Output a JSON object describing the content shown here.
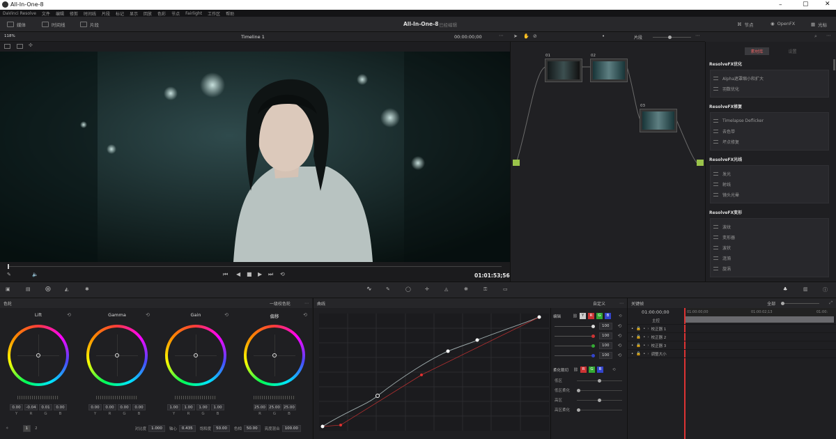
{
  "window": {
    "title": "All-In-One-8"
  },
  "menu": [
    "DaVinci Resolve",
    "文件",
    "编辑",
    "修剪",
    "时间线",
    "片段",
    "标记",
    "显示",
    "回放",
    "色彩",
    "节点",
    "Fairlight",
    "工作区",
    "帮助"
  ],
  "pagebar": {
    "left": [
      "媒体",
      "时间线",
      "片段"
    ],
    "project": "All-In-One-8",
    "status": "已经编辑",
    "right": [
      "节点",
      "OpenFX",
      "光标"
    ]
  },
  "viewer": {
    "zoom": "118%",
    "timeline_name": "Timeline 1",
    "timecode_top": "00:00:00;00",
    "timecode": "01:01:53;56",
    "clip_mode": "片段"
  },
  "nodes": [
    {
      "label": "01"
    },
    {
      "label": "02"
    },
    {
      "label": "03"
    }
  ],
  "openfx": {
    "tabs": [
      "素材库",
      "设置"
    ],
    "categories": [
      {
        "name": "ResolveFX优化",
        "items": [
          "Alpha遮罩缩小和扩大",
          "羽数优化"
        ]
      },
      {
        "name": "ResolveFX修复",
        "items": [
          "Timelapse Deflicker",
          "去色带",
          "坏点修复"
        ]
      },
      {
        "name": "ResolveFX光线",
        "items": [
          "发光",
          "射线",
          "镜头光晕"
        ]
      },
      {
        "name": "ResolveFX变形",
        "items": [
          "波纹",
          "变形器",
          "波状",
          "涟漪",
          "旋涡"
        ]
      }
    ]
  },
  "wheels": {
    "title": "色轮",
    "mode": "一级校色轮",
    "items": [
      {
        "name": "Lift",
        "values": [
          "0.00",
          "-0.04",
          "0.01",
          "0.00"
        ]
      },
      {
        "name": "Gamma",
        "values": [
          "0.00",
          "0.00",
          "0.00",
          "0.00"
        ]
      },
      {
        "name": "Gain",
        "values": [
          "1.00",
          "1.00",
          "1.00",
          "1.00"
        ]
      },
      {
        "name": "偏移",
        "values": [
          "25.00",
          "25.00",
          "25.00"
        ]
      }
    ],
    "labels4": [
      "Y",
      "R",
      "G",
      "B"
    ],
    "labels3": [
      "R",
      "G",
      "B"
    ],
    "footer": {
      "pages": [
        "1",
        "2"
      ],
      "contrast_label": "对比度",
      "contrast": "1.000",
      "pivot_label": "轴心",
      "pivot": "0.435",
      "sat_label": "饱和度",
      "sat": "50.00",
      "hue_label": "色相",
      "hue": "50.00",
      "lummix_label": "亮度混合",
      "lummix": "100.00"
    }
  },
  "curves": {
    "title": "曲线",
    "mode": "自定义",
    "edit_label": "编辑",
    "edit_values": [
      "100",
      "100",
      "100",
      "100"
    ],
    "soft_label": "柔化裁切",
    "soft_rows": [
      "低区",
      "低区柔化",
      "高区",
      "高区柔化"
    ]
  },
  "keyframes": {
    "title": "关键帧",
    "filter": "全部",
    "timecode": "01:00:00;00",
    "ruler": [
      "01:00:00;00",
      "01:00:02;13",
      "01:00:"
    ],
    "rows": [
      "主控",
      "校正器 1",
      "校正器 2",
      "校正器 3",
      "调整大小"
    ]
  }
}
